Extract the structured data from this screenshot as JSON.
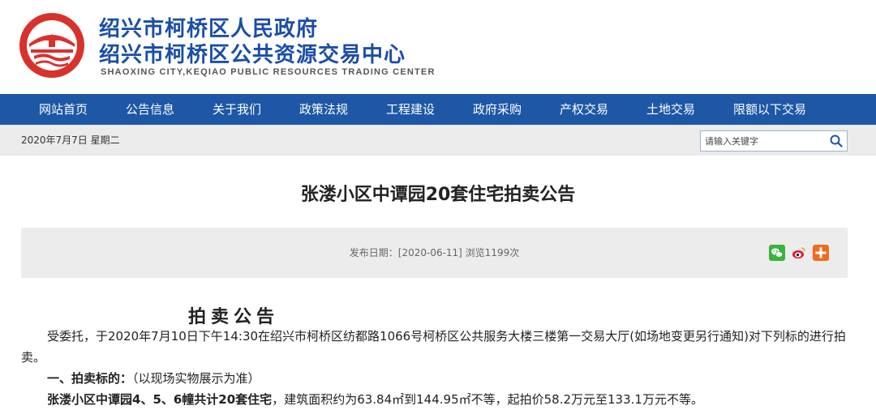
{
  "header": {
    "title_line1": "绍兴市柯桥区人民政府",
    "title_line2": "绍兴市柯桥区公共资源交易中心",
    "title_en": "SHAOXING CITY,KEQIAO PUBLIC RESOURCES TRADING CENTER",
    "brand_color": "#1a4ea8",
    "logo_color": "#d8322c"
  },
  "nav": {
    "background": "#1d57a5",
    "items": [
      {
        "label": "网站首页"
      },
      {
        "label": "公告信息"
      },
      {
        "label": "关于我们"
      },
      {
        "label": "政策法规"
      },
      {
        "label": "工程建设"
      },
      {
        "label": "政府采购"
      },
      {
        "label": "产权交易"
      },
      {
        "label": "土地交易"
      },
      {
        "label": "限额以下交易"
      }
    ]
  },
  "infobar": {
    "date": "2020年7月7日 星期二",
    "search_placeholder": "请输入关键字",
    "search_icon": "search-icon"
  },
  "article": {
    "title": "张溇小区中谭园20套住宅拍卖公告",
    "meta": "发布日期：[2020-06-11] 浏览1199次",
    "share_icons": [
      "wechat-icon",
      "weibo-icon",
      "share-more-icon"
    ],
    "heading": "拍卖公告",
    "paragraph": "受委托，于2020年7月10日下午14:30在绍兴市柯桥区纺都路1066号柯桥区公共服务大楼三楼第一交易大厅(如场地变更另行通知)对下列标的进行拍卖。",
    "item1_label": "一、拍卖标的：",
    "item1_text": "（以现场实物展示为准）",
    "item2_bold": "张溇小区中谭园4、5、6幢共计20套住宅",
    "item2_text": "，建筑面积约为63.84㎡到144.95㎡不等，起拍价58.2万元至133.1万元不等。"
  }
}
